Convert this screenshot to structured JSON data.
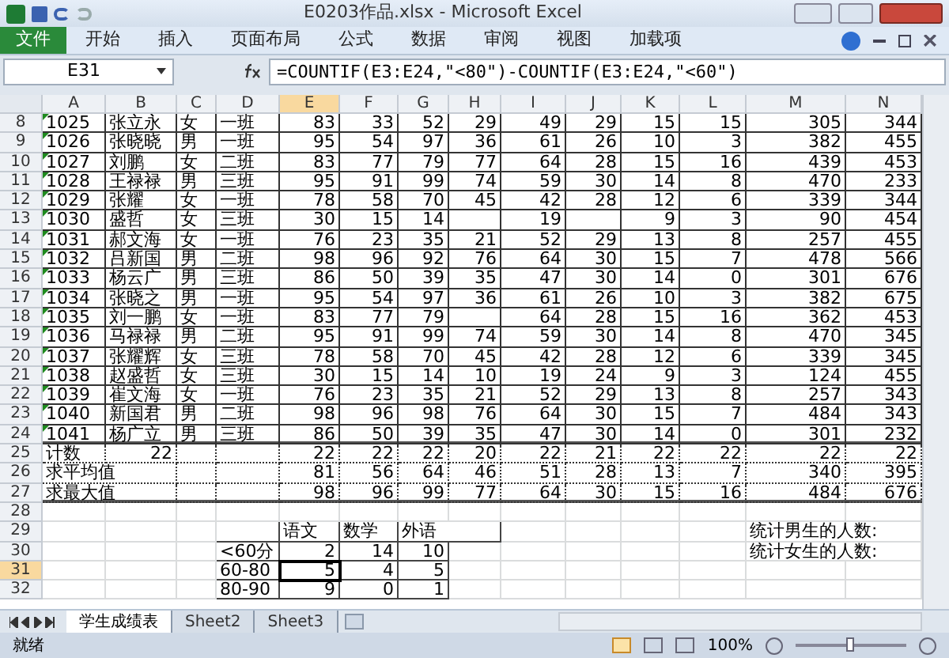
{
  "window": {
    "title": "E0203作品.xlsx - Microsoft Excel"
  },
  "ribbon_tabs": [
    {
      "label": "文件",
      "kind": "file",
      "selected": false
    },
    {
      "label": "开始",
      "kind": "tab",
      "selected": false
    },
    {
      "label": "插入",
      "kind": "tab",
      "selected": false
    },
    {
      "label": "页面布局",
      "kind": "tab",
      "selected": false
    },
    {
      "label": "公式",
      "kind": "tab",
      "selected": false
    },
    {
      "label": "数据",
      "kind": "tab",
      "selected": false
    },
    {
      "label": "审阅",
      "kind": "tab",
      "selected": false
    },
    {
      "label": "视图",
      "kind": "tab",
      "selected": false
    },
    {
      "label": "加载项",
      "kind": "tab",
      "selected": false
    }
  ],
  "formula_bar": {
    "name_box": "E31",
    "formula": "=COUNTIF(E3:E24,\"<80\")-COUNTIF(E3:E24,\"<60\")"
  },
  "columns": [
    {
      "label": "A",
      "selected": false
    },
    {
      "label": "B",
      "selected": false
    },
    {
      "label": "C",
      "selected": false
    },
    {
      "label": "D",
      "selected": false
    },
    {
      "label": "E",
      "selected": true
    },
    {
      "label": "F",
      "selected": false
    },
    {
      "label": "G",
      "selected": false
    },
    {
      "label": "H",
      "selected": false
    },
    {
      "label": "I",
      "selected": false
    },
    {
      "label": "J",
      "selected": false
    },
    {
      "label": "K",
      "selected": false
    },
    {
      "label": "L",
      "selected": false
    },
    {
      "label": "M",
      "selected": false
    },
    {
      "label": "N",
      "selected": false
    }
  ],
  "rows": [
    {
      "number": "8",
      "kind": "data",
      "selected": false,
      "flagged": true,
      "cells": [
        "1025",
        "张立永",
        "女",
        "一班",
        "83",
        "33",
        "52",
        "29",
        "49",
        "29",
        "15",
        "15",
        "305",
        "344"
      ]
    },
    {
      "number": "9",
      "kind": "data",
      "selected": false,
      "flagged": true,
      "cells": [
        "1026",
        "张晓晓",
        "男",
        "一班",
        "95",
        "54",
        "97",
        "36",
        "61",
        "26",
        "10",
        "3",
        "382",
        "455"
      ]
    },
    {
      "number": "10",
      "kind": "data",
      "selected": false,
      "flagged": true,
      "cells": [
        "1027",
        "刘鹏",
        "女",
        "二班",
        "83",
        "77",
        "79",
        "77",
        "64",
        "28",
        "15",
        "16",
        "439",
        "453"
      ]
    },
    {
      "number": "11",
      "kind": "data",
      "selected": false,
      "flagged": true,
      "cells": [
        "1028",
        "王禄禄",
        "男",
        "三班",
        "95",
        "91",
        "99",
        "74",
        "59",
        "30",
        "14",
        "8",
        "470",
        "233"
      ]
    },
    {
      "number": "12",
      "kind": "data",
      "selected": false,
      "flagged": true,
      "cells": [
        "1029",
        "张耀",
        "女",
        "一班",
        "78",
        "58",
        "70",
        "45",
        "42",
        "28",
        "12",
        "6",
        "339",
        "344"
      ]
    },
    {
      "number": "13",
      "kind": "data",
      "selected": false,
      "flagged": true,
      "cells": [
        "1030",
        "盛哲",
        "女",
        "三班",
        "30",
        "15",
        "14",
        null,
        "19",
        null,
        "9",
        "3",
        "90",
        "454"
      ]
    },
    {
      "number": "14",
      "kind": "data",
      "selected": false,
      "flagged": true,
      "cells": [
        "1031",
        "郝文海",
        "女",
        "一班",
        "76",
        "23",
        "35",
        "21",
        "52",
        "29",
        "13",
        "8",
        "257",
        "455"
      ]
    },
    {
      "number": "15",
      "kind": "data",
      "selected": false,
      "flagged": true,
      "cells": [
        "1032",
        "吕新国",
        "男",
        "二班",
        "98",
        "96",
        "92",
        "76",
        "64",
        "30",
        "15",
        "7",
        "478",
        "566"
      ]
    },
    {
      "number": "16",
      "kind": "data",
      "selected": false,
      "flagged": true,
      "cells": [
        "1033",
        "杨云广",
        "男",
        "三班",
        "86",
        "50",
        "39",
        "35",
        "47",
        "30",
        "14",
        "0",
        "301",
        "676"
      ]
    },
    {
      "number": "17",
      "kind": "data",
      "selected": false,
      "flagged": true,
      "cells": [
        "1034",
        "张晓之",
        "男",
        "一班",
        "95",
        "54",
        "97",
        "36",
        "61",
        "26",
        "10",
        "3",
        "382",
        "675"
      ]
    },
    {
      "number": "18",
      "kind": "data",
      "selected": false,
      "flagged": true,
      "cells": [
        "1035",
        "刘一鹏",
        "女",
        "一班",
        "83",
        "77",
        "79",
        null,
        "64",
        "28",
        "15",
        "16",
        "362",
        "453"
      ]
    },
    {
      "number": "19",
      "kind": "data",
      "selected": false,
      "flagged": true,
      "cells": [
        "1036",
        "马禄禄",
        "男",
        "二班",
        "95",
        "91",
        "99",
        "74",
        "59",
        "30",
        "14",
        "8",
        "470",
        "345"
      ]
    },
    {
      "number": "20",
      "kind": "data",
      "selected": false,
      "flagged": true,
      "cells": [
        "1037",
        "张耀辉",
        "女",
        "三班",
        "78",
        "58",
        "70",
        "45",
        "42",
        "28",
        "12",
        "6",
        "339",
        "345"
      ]
    },
    {
      "number": "21",
      "kind": "data",
      "selected": false,
      "flagged": true,
      "cells": [
        "1038",
        "赵盛哲",
        "女",
        "三班",
        "30",
        "15",
        "14",
        "10",
        "19",
        "24",
        "9",
        "3",
        "124",
        "455"
      ]
    },
    {
      "number": "22",
      "kind": "data",
      "selected": false,
      "flagged": true,
      "cells": [
        "1039",
        "崔文海",
        "女",
        "一班",
        "76",
        "23",
        "35",
        "21",
        "52",
        "29",
        "13",
        "8",
        "257",
        "343"
      ]
    },
    {
      "number": "23",
      "kind": "data",
      "selected": false,
      "flagged": true,
      "cells": [
        "1040",
        "新国君",
        "男",
        "二班",
        "98",
        "96",
        "98",
        "76",
        "64",
        "30",
        "15",
        "7",
        "484",
        "343"
      ]
    },
    {
      "number": "24",
      "kind": "data",
      "selected": false,
      "flagged": true,
      "cells": [
        "1041",
        "杨广立",
        "男",
        "三班",
        "86",
        "50",
        "39",
        "35",
        "47",
        "30",
        "14",
        "0",
        "301",
        "232"
      ]
    },
    {
      "number": "25",
      "kind": "summary",
      "selected": false,
      "cells": [
        "计数",
        "22",
        null,
        null,
        "22",
        "22",
        "22",
        "20",
        "22",
        "21",
        "22",
        "22",
        "22",
        "22"
      ]
    },
    {
      "number": "26",
      "kind": "summary",
      "selected": false,
      "cells": [
        "求平均值",
        null,
        null,
        null,
        "81",
        "56",
        "64",
        "46",
        "51",
        "28",
        "13",
        "7",
        "340",
        "395"
      ]
    },
    {
      "number": "27",
      "kind": "summary",
      "selected": false,
      "cells": [
        "求最大值",
        null,
        null,
        null,
        "98",
        "96",
        "99",
        "77",
        "64",
        "30",
        "15",
        "16",
        "484",
        "676"
      ]
    },
    {
      "number": "28",
      "kind": "plain",
      "selected": false,
      "cells": [
        null,
        null,
        null,
        null,
        null,
        null,
        null,
        null,
        null,
        null,
        null,
        null,
        null,
        null
      ]
    },
    {
      "number": "29",
      "kind": "mini",
      "selected": false,
      "cells": [
        null,
        null,
        null,
        null,
        "语文",
        "数学",
        "外语",
        null,
        null,
        null,
        null,
        null,
        "统计男生的人数:",
        null
      ]
    },
    {
      "number": "30",
      "kind": "mini",
      "selected": false,
      "cells": [
        null,
        null,
        null,
        "<60分",
        "2",
        "14",
        "10",
        null,
        null,
        null,
        null,
        null,
        "统计女生的人数:",
        null
      ]
    },
    {
      "number": "31",
      "kind": "mini",
      "selected": true,
      "cells": [
        null,
        null,
        null,
        "60-80",
        "5",
        "4",
        "5",
        null,
        null,
        null,
        null,
        null,
        null,
        null
      ]
    },
    {
      "number": "32",
      "kind": "mini",
      "selected": false,
      "cells": [
        null,
        null,
        null,
        "80-90",
        "9",
        "0",
        "1",
        null,
        null,
        null,
        null,
        null,
        null,
        null
      ]
    }
  ],
  "sheet_tabs": [
    {
      "label": "学生成绩表",
      "selected": true
    },
    {
      "label": "Sheet2",
      "selected": false
    },
    {
      "label": "Sheet3",
      "selected": false
    }
  ],
  "status_bar": {
    "status": "就绪",
    "zoom": "100%",
    "zoom_slider": {
      "level": 0.5
    }
  }
}
